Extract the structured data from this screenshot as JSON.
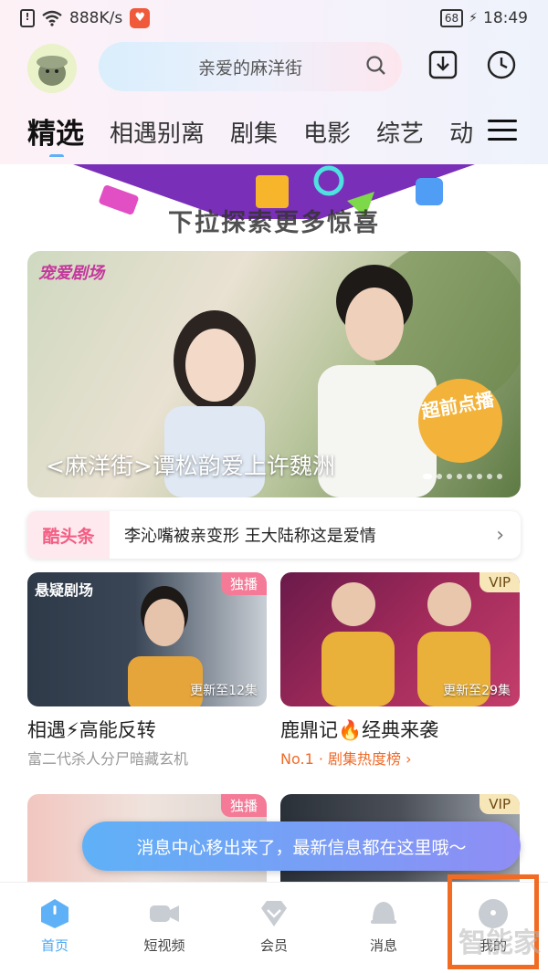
{
  "status": {
    "speed": "888K/s",
    "battery": "68",
    "time": "18:49",
    "sim_icon": "sim-alert-icon"
  },
  "header": {
    "search_text": "亲爱的麻洋街"
  },
  "tabs": [
    {
      "label": "精选"
    },
    {
      "label": "相遇别离"
    },
    {
      "label": "剧集"
    },
    {
      "label": "电影"
    },
    {
      "label": "综艺"
    },
    {
      "label": "动"
    }
  ],
  "promo": {
    "text": "下拉探索更多惊喜"
  },
  "hero": {
    "show_logo": "宠爱剧场",
    "title": "<麻洋街>谭松韵爱上许魏洲",
    "badge": "超前点播",
    "active_slide": 1,
    "slide_count": 8
  },
  "ticker": {
    "tag": "酷头条",
    "text": "李沁嘴被亲变形 王大陆称这是爱情"
  },
  "cards": [
    {
      "corner": "独播",
      "logo": "悬疑剧场",
      "update": "更新至12集",
      "title": "相遇⚡高能反转",
      "sub": "富二代杀人分尸暗藏玄机"
    },
    {
      "corner": "VIP",
      "update": "更新至29集",
      "title": "鹿鼎记🔥经典来袭",
      "sub": "No.1 · 剧集热度榜 ›"
    },
    {
      "corner": "独播"
    },
    {
      "corner": "VIP"
    }
  ],
  "toast": {
    "text": "消息中心移出来了，最新信息都在这里哦～"
  },
  "nav": [
    {
      "label": "首页",
      "icon": "home-icon"
    },
    {
      "label": "短视频",
      "icon": "video-camera-icon"
    },
    {
      "label": "会员",
      "icon": "diamond-icon"
    },
    {
      "label": "消息",
      "icon": "bell-icon"
    },
    {
      "label": "我的",
      "icon": "profile-icon"
    }
  ],
  "watermark": "智能家",
  "colors": {
    "accent": "#4aa8f3",
    "highlight": "#f26b22",
    "tag_pink": "#f35d83"
  }
}
